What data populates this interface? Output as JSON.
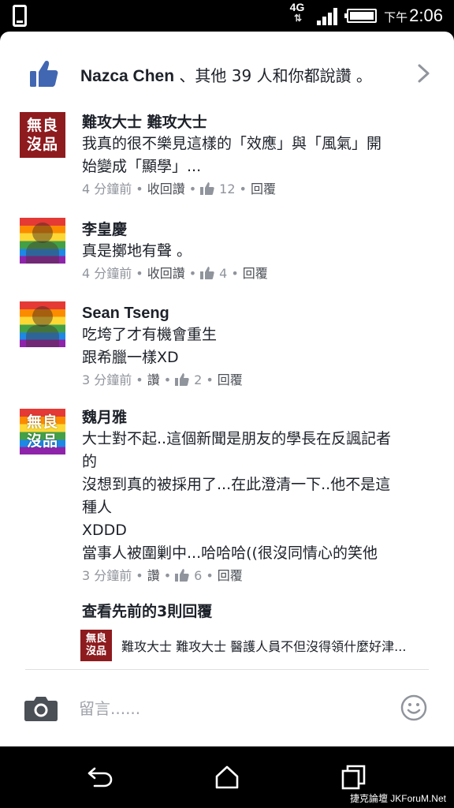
{
  "status_bar": {
    "network": "4G",
    "network_arrows": "⇅",
    "ampm": "下午",
    "time": "2:06"
  },
  "likes": {
    "name": "Nazca Chen",
    "rest": " 、其他 39 人和你都說讚 。"
  },
  "comments": [
    {
      "avatar_text": [
        "無良",
        "沒品"
      ],
      "name": "難攻大士 難攻大士",
      "lines": [
        "我真的很不樂見這樣的「效應」與「風氣」開",
        "始變成「顯學」..."
      ],
      "time": "4 分鐘前",
      "action": "收回讚",
      "likes": "12",
      "reply": "回覆"
    },
    {
      "name": "李皇慶",
      "lines": [
        "真是擲地有聲 。"
      ],
      "time": "4 分鐘前",
      "action": "收回讚",
      "likes": "4",
      "reply": "回覆"
    },
    {
      "name": "Sean Tseng",
      "lines": [
        "吃垮了才有機會重生",
        "跟希臘一樣XD"
      ],
      "time": "3 分鐘前",
      "action": "讚",
      "likes": "2",
      "reply": "回覆"
    },
    {
      "avatar_text": [
        "無良",
        "沒品"
      ],
      "name": "魏月雅",
      "lines": [
        "大士對不起..這個新聞是朋友的學長在反諷記者",
        "的",
        "沒想到真的被採用了...在此澄清一下..他不是這",
        "種人",
        "XDDD",
        "當事人被圍剿中...哈哈哈((很沒同情心的笑他"
      ],
      "time": "3 分鐘前",
      "action": "讚",
      "likes": "6",
      "reply": "回覆"
    }
  ],
  "previous_replies": "查看先前的3則回覆",
  "reply_preview": {
    "avatar_text": [
      "無良",
      "沒品"
    ],
    "text": "難攻大士 難攻大士  醫護人員不但沒得領什麼好津..."
  },
  "composer": {
    "placeholder": "留言......"
  },
  "watermark": "捷克論壇 JKForuM.Net",
  "colors": {
    "like_blue": "#4267b2",
    "meta_gray": "#90949c",
    "brand_red": "#8e1b1e"
  },
  "icons": [
    "phone-icon",
    "signal-icon",
    "battery-icon",
    "like-thumb-icon",
    "chevron-right-icon",
    "camera-icon",
    "smiley-icon",
    "back-icon",
    "home-icon",
    "recents-icon"
  ]
}
